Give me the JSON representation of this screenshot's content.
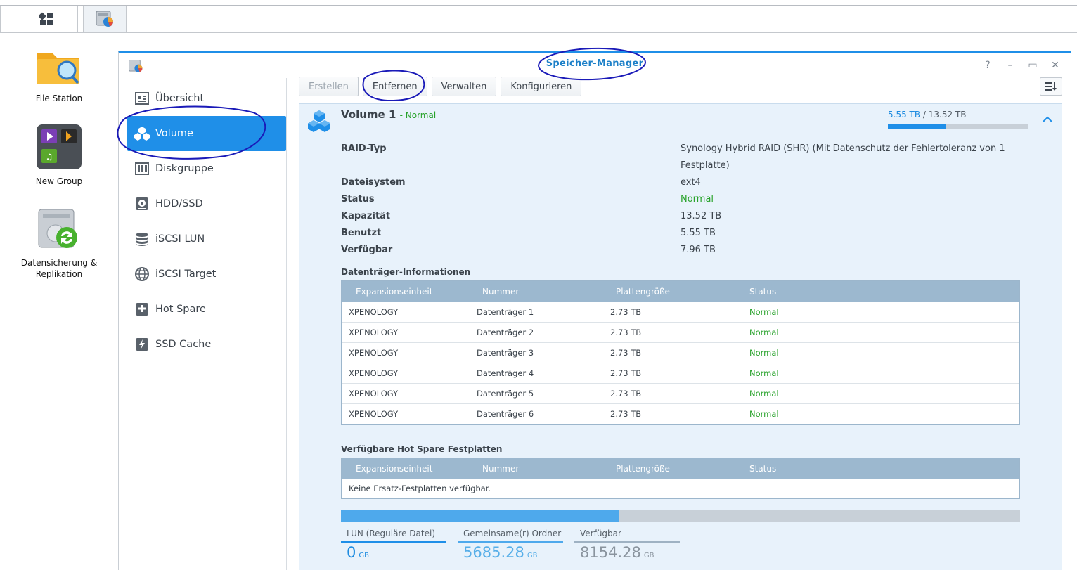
{
  "taskbar": {
    "items": [
      {
        "icon": "app-grid-icon"
      },
      {
        "icon": "storage-manager-icon"
      }
    ]
  },
  "desktop": {
    "icons": [
      {
        "label": "File Station",
        "icon": "file-station-icon"
      },
      {
        "label": "New Group",
        "icon": "app-group-icon"
      },
      {
        "label": "Datensicherung & Replikation",
        "icon": "backup-replication-icon"
      }
    ]
  },
  "window": {
    "title": "Speicher-Manager",
    "controls": [
      "?",
      "–",
      "▭",
      "✕"
    ]
  },
  "sidebar": {
    "items": [
      {
        "label": "Übersicht",
        "icon": "overview-icon"
      },
      {
        "label": "Volume",
        "icon": "volume-icon",
        "active": true
      },
      {
        "label": "Diskgruppe",
        "icon": "diskgroup-icon"
      },
      {
        "label": "HDD/SSD",
        "icon": "hdd-icon"
      },
      {
        "label": "iSCSI LUN",
        "icon": "database-icon"
      },
      {
        "label": "iSCSI Target",
        "icon": "globe-icon"
      },
      {
        "label": "Hot Spare",
        "icon": "hot-spare-icon"
      },
      {
        "label": "SSD Cache",
        "icon": "ssd-cache-icon"
      }
    ]
  },
  "toolbar": {
    "create": "Erstellen",
    "remove": "Entfernen",
    "manage": "Verwalten",
    "configure": "Konfigurieren"
  },
  "volume": {
    "title": "Volume 1",
    "status_suffix": "- Normal",
    "used": "5.55 TB",
    "sep": " / ",
    "total": "13.52 TB",
    "usage_fraction": 0.41,
    "info": [
      {
        "key": "RAID-Typ",
        "value": "Synology Hybrid RAID (SHR) (Mit Datenschutz der Fehlertoleranz von 1 Festplatte)"
      },
      {
        "key": "Dateisystem",
        "value": "ext4"
      },
      {
        "key": "Status",
        "value": "Normal"
      },
      {
        "key": "Kapazität",
        "value": "13.52 TB"
      },
      {
        "key": "Benutzt",
        "value": "5.55 TB"
      },
      {
        "key": "Verfügbar",
        "value": "7.96 TB"
      }
    ]
  },
  "disk_info": {
    "title": "Datenträger-Informationen",
    "headers": [
      "Expansionseinheit",
      "Nummer",
      "Plattengröße",
      "Status"
    ],
    "rows": [
      [
        "XPENOLOGY",
        "Datenträger 1",
        "2.73 TB",
        "Normal"
      ],
      [
        "XPENOLOGY",
        "Datenträger 2",
        "2.73 TB",
        "Normal"
      ],
      [
        "XPENOLOGY",
        "Datenträger 3",
        "2.73 TB",
        "Normal"
      ],
      [
        "XPENOLOGY",
        "Datenträger 4",
        "2.73 TB",
        "Normal"
      ],
      [
        "XPENOLOGY",
        "Datenträger 5",
        "2.73 TB",
        "Normal"
      ],
      [
        "XPENOLOGY",
        "Datenträger 6",
        "2.73 TB",
        "Normal"
      ]
    ]
  },
  "hot_spare": {
    "title": "Verfügbare Hot Spare Festplatten",
    "headers": [
      "Expansionseinheit",
      "Nummer",
      "Plattengröße",
      "Status"
    ],
    "empty": "Keine Ersatz-Festplatten verfügbar."
  },
  "usage_breakdown": {
    "segments": [
      {
        "label": "LUN (Reguläre Datei)",
        "value": "0",
        "unit": "GB",
        "fraction": 0.0
      },
      {
        "label": "Gemeinsame(r) Ordner",
        "value": "5685.28",
        "unit": "GB",
        "fraction": 0.41
      },
      {
        "label": "Verfügbar",
        "value": "8154.28",
        "unit": "GB",
        "fraction": 0.59
      }
    ]
  },
  "colors": {
    "accent": "#1f8fe8",
    "status_ok": "#27a22a",
    "annotation_ink": "#1a1ab8"
  }
}
